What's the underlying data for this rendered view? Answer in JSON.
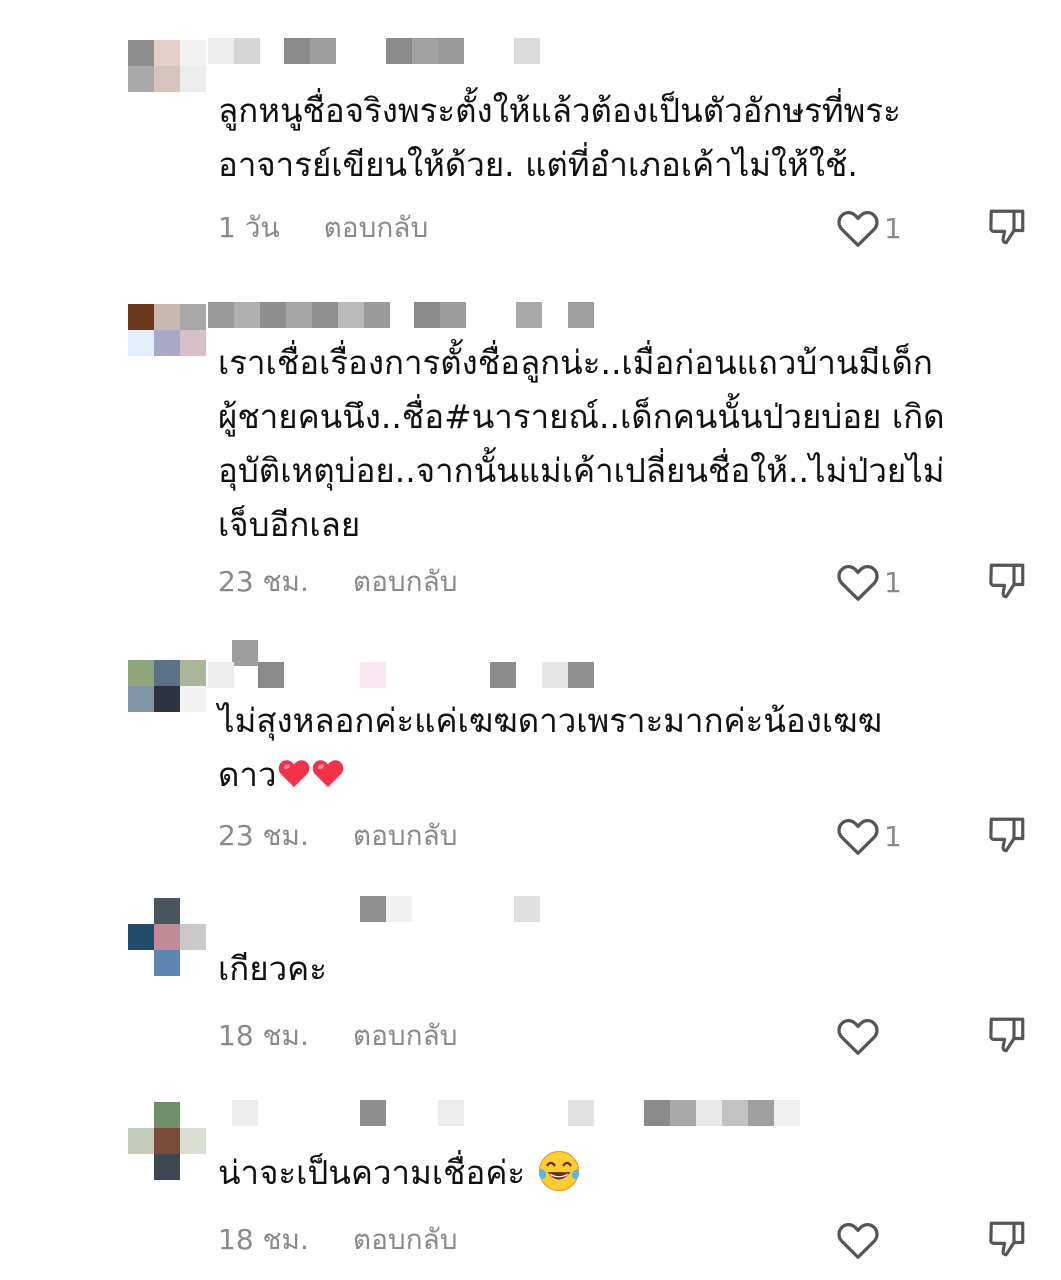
{
  "comments": [
    {
      "text": "ลูกหนูชื่อจริงพระตั้งให้แล้วต้องเป็นตัวอักษรที่พระ\nอาจารย์เขียนให้ด้วย. แต่ที่อำเภอเค้าไม่ให้ใช้.",
      "time": "1 วัน",
      "reply": "ตอบกลับ",
      "likes": "1"
    },
    {
      "text": "เราเชื่อเรื่องการตั้งชื่อลูกน่ะ..เมื่อก่อนแถวบ้านมีเด็ก\nผู้ชายคนนึง..ชื่อ#นารายณ์..เด็กคนนั้นป่วยบ่อย เกิด\nอุบัติเหตุบ่อย..จากนั้นแม่เค้าเปลี่ยนชื่อให้..ไม่ป่วยไม่\nเจ็บอีกเลย",
      "time": "23 ชม.",
      "reply": "ตอบกลับ",
      "likes": "1"
    },
    {
      "text_line1": "ไม่สุงหลอกค่ะแค่เฆฆดาวเพราะมากค่ะน้องเฆฆ",
      "text_line2": "ดาว",
      "time": "23 ชม.",
      "reply": "ตอบกลับ",
      "likes": "1"
    },
    {
      "text": "เกียวคะ",
      "time": "18 ชม.",
      "reply": "ตอบกลับ",
      "likes": ""
    },
    {
      "text": "น่าจะเป็นความเชื่อค่ะ",
      "time": "18 ชม.",
      "reply": "ตอบกลับ",
      "likes": ""
    }
  ],
  "icons": {
    "like": "heart-outline-icon",
    "dislike": "thumbs-down-outline-icon",
    "heart_emoji": "red-heart-emoji",
    "laugh_emoji": "tears-of-joy-emoji"
  },
  "colors": {
    "text": "#111111",
    "meta": "#8a8a8a",
    "icon": "#555555",
    "heart": "#f0324b"
  }
}
